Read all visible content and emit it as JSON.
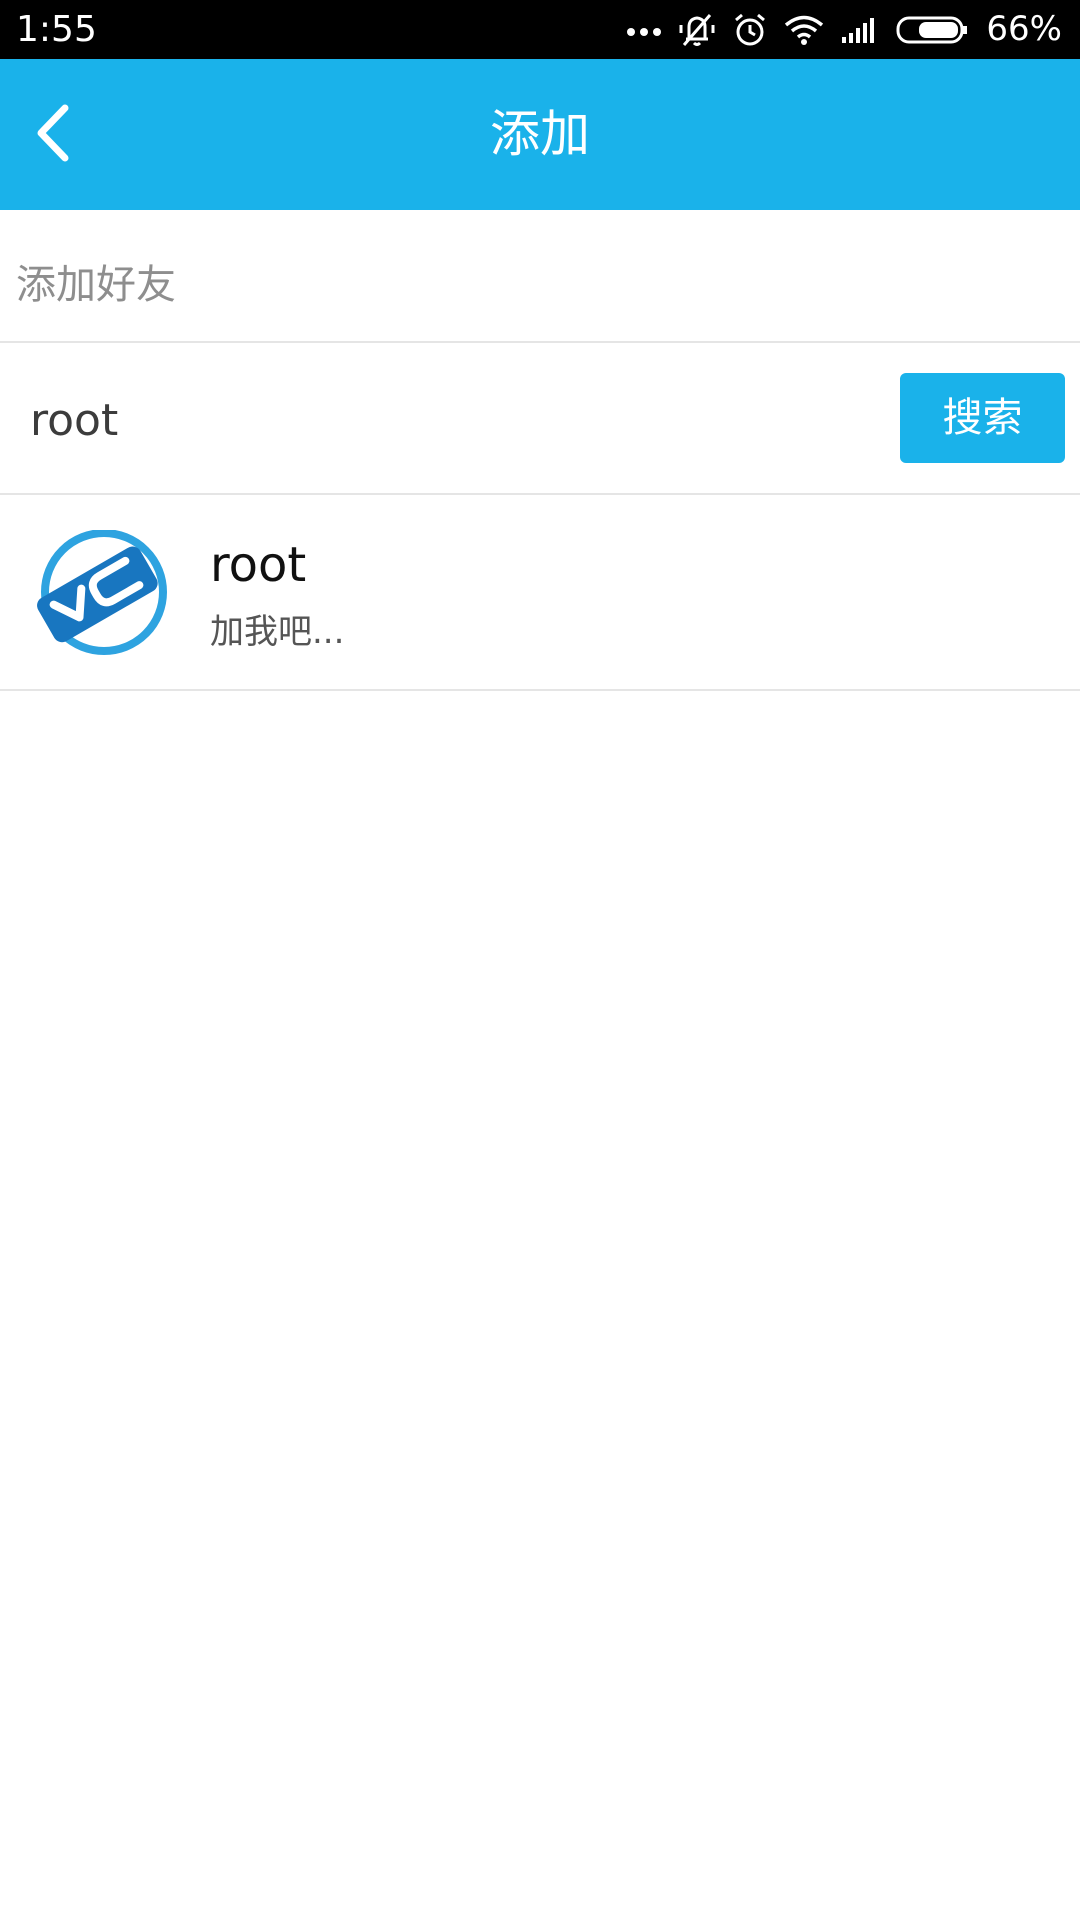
{
  "status_bar": {
    "time": "1:55",
    "battery": "66%",
    "icons": [
      "more-dots-icon",
      "vibrate-off-icon",
      "alarm-icon",
      "wifi-icon",
      "signal-icon",
      "battery-icon"
    ]
  },
  "header": {
    "title": "添加",
    "back_icon": "chevron-left-icon"
  },
  "section": {
    "label": "添加好友"
  },
  "search": {
    "value": "root",
    "button_label": "搜索"
  },
  "results": [
    {
      "name": "root",
      "signature": "加我吧..."
    }
  ],
  "colors": {
    "accent": "#1ab2ea",
    "status_bar": "#000000",
    "divider": "#e5e5e5"
  }
}
